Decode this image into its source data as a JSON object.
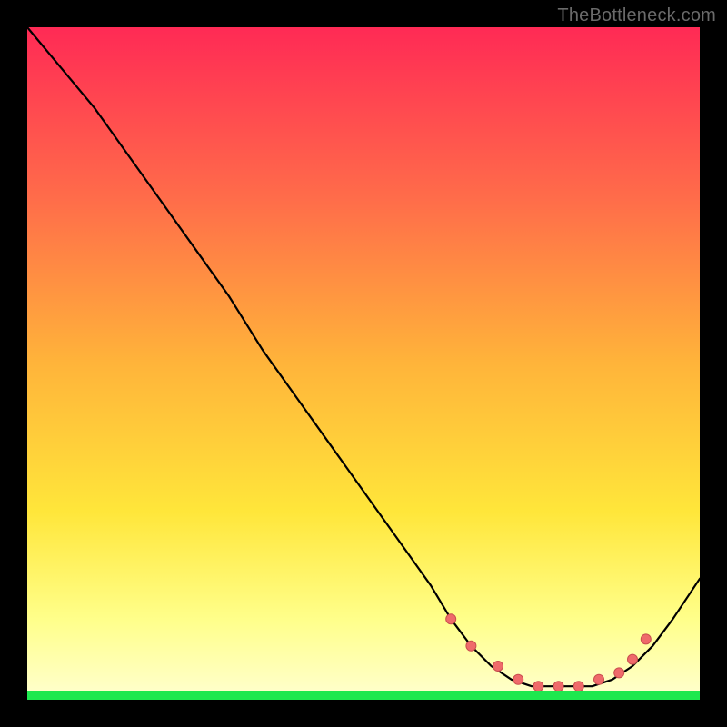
{
  "watermark": "TheBottleneck.com",
  "colors": {
    "gradient_top": "#ff2a55",
    "gradient_upper": "#ff6b4a",
    "gradient_mid": "#ffb43a",
    "gradient_lower": "#ffe63a",
    "gradient_band": "#ffff8a",
    "gradient_bottom": "#ffffd0",
    "green_strip": "#1ee84e",
    "curve_stroke": "#000000",
    "marker_fill": "#ef6a6a",
    "marker_stroke": "#c94f4f"
  },
  "chart_data": {
    "type": "line",
    "title": "",
    "xlabel": "",
    "ylabel": "",
    "xlim": [
      0,
      100
    ],
    "ylim": [
      0,
      100
    ],
    "grid": false,
    "legend": "none",
    "series": [
      {
        "name": "curve",
        "x": [
          0,
          5,
          10,
          15,
          20,
          25,
          30,
          35,
          40,
          45,
          50,
          55,
          60,
          63,
          66,
          69,
          72,
          75,
          78,
          81,
          84,
          87,
          90,
          93,
          96,
          100
        ],
        "y": [
          100,
          94,
          88,
          81,
          74,
          67,
          60,
          52,
          45,
          38,
          31,
          24,
          17,
          12,
          8,
          5,
          3,
          2,
          2,
          2,
          2,
          3,
          5,
          8,
          12,
          18
        ]
      }
    ],
    "markers": {
      "series": "curve",
      "x": [
        63,
        66,
        70,
        73,
        76,
        79,
        82,
        85,
        88,
        90,
        92
      ],
      "y": [
        12,
        8,
        5,
        3,
        2,
        2,
        2,
        3,
        4,
        6,
        9
      ]
    }
  }
}
